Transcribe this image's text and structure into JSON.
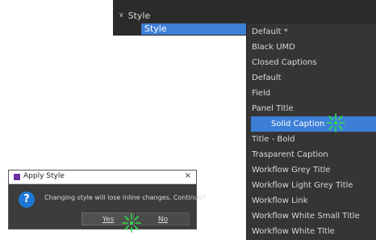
{
  "property_panel": {
    "section_label": "Style",
    "field_value": "Style"
  },
  "style_dropdown": {
    "options": [
      "Default *",
      "Black UMD",
      "Closed Captions",
      "Default",
      "Field",
      "Panel Title",
      "Solid Caption",
      "Title - Bold",
      "Trasparent Caption",
      "Workflow Grey Title",
      "Workflow Light Grey Title",
      "Workflow Link",
      "Workflow White Small Title",
      "Workflow White Title"
    ],
    "selected_index": 6
  },
  "dialog": {
    "title": "Apply Style",
    "close": "×",
    "icon_glyph": "?",
    "message": "Changing style will lose inline changes. Continue?",
    "yes_label": "Yes",
    "no_label": "No"
  },
  "colors": {
    "selection": "#3d7fd6",
    "click_marker": "#2fe04a"
  }
}
